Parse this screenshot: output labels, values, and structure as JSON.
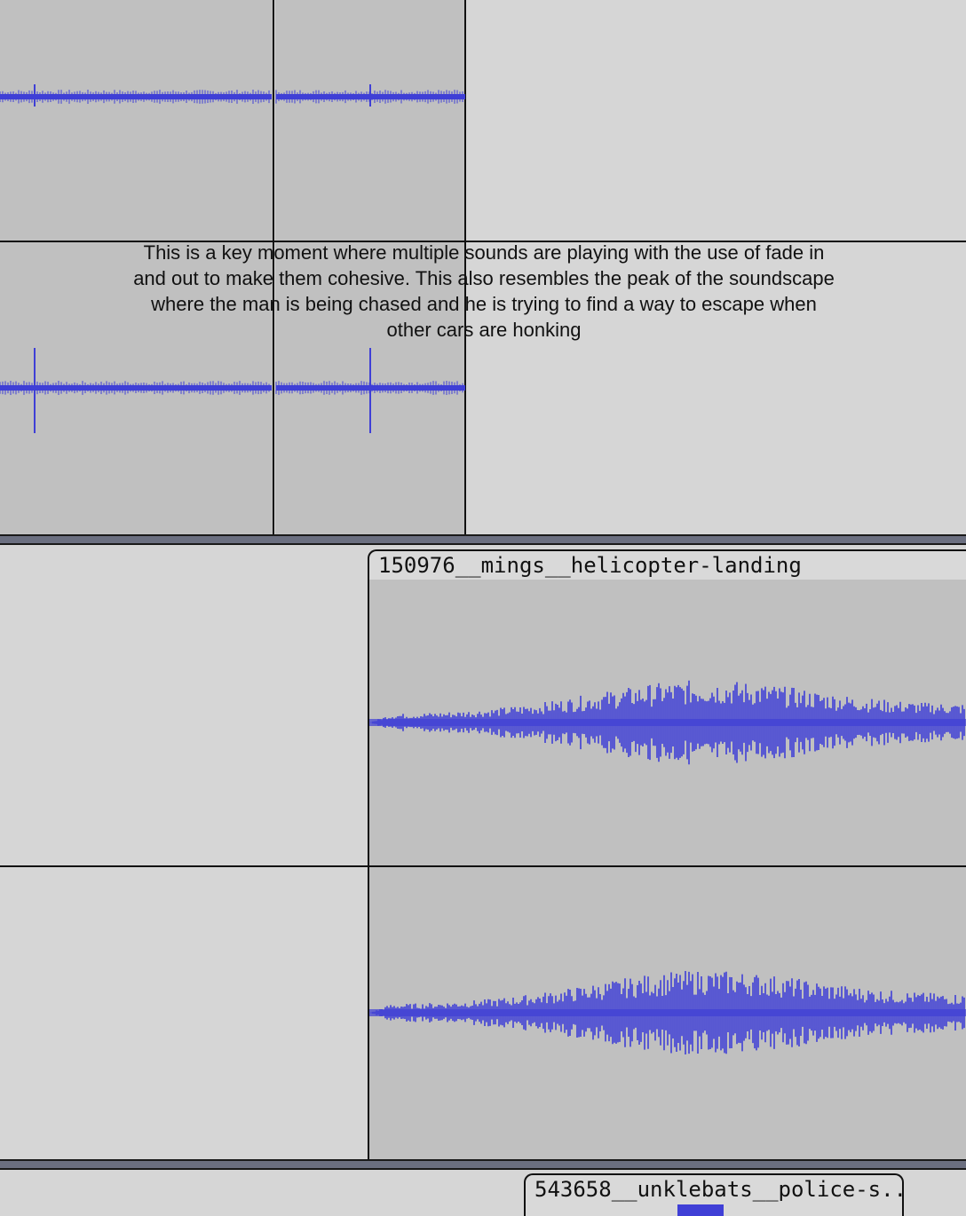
{
  "tracks": [
    {
      "id": "track-upper",
      "channels": 2
    },
    {
      "id": "track-helicopter",
      "clip_name": "150976__mings__helicopter-landing",
      "channels": 2
    },
    {
      "id": "track-police",
      "clip_name": "543658__unklebats__police-s..."
    }
  ],
  "annotation": {
    "text": "This is a key moment where multiple sounds are playing with the use of fade in and out to make them cohesive. This also resembles the peak of the soundscape where the man is being chased and he is trying to find a way to escape when other cars are honking"
  },
  "colors": {
    "waveform": "#3f3fd6",
    "clip_bg": "#c0c0c0",
    "empty_bg": "#d6d6d6",
    "separator": "#6b6f80"
  }
}
